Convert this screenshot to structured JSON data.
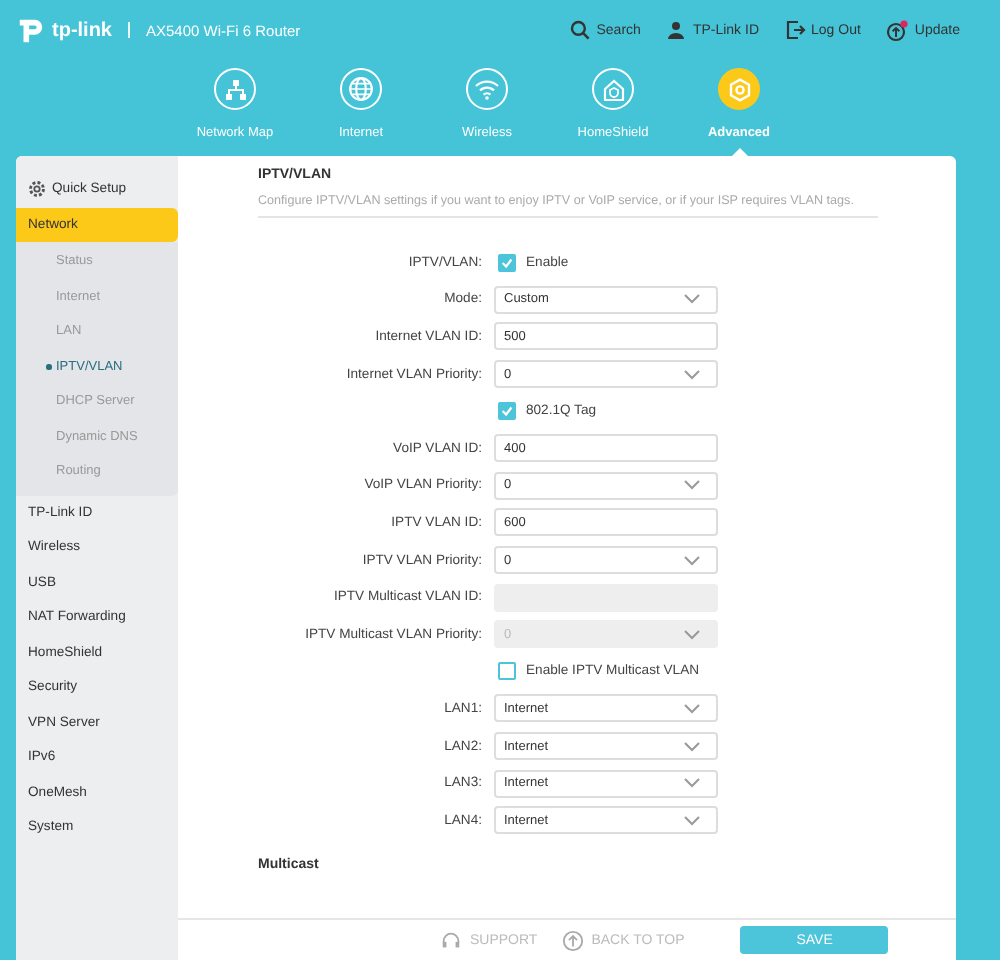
{
  "header": {
    "logo": "tp-link",
    "model": "AX5400 Wi-Fi 6 Router",
    "links": [
      {
        "label": "Search",
        "kind": "search"
      },
      {
        "label": "TP-Link ID",
        "kind": "user"
      },
      {
        "label": "Log Out",
        "kind": "logout"
      },
      {
        "label": "Update",
        "kind": "update"
      }
    ]
  },
  "nav": [
    {
      "label": "Network Map",
      "kind": "map",
      "selected": false
    },
    {
      "label": "Internet",
      "kind": "globe",
      "selected": false
    },
    {
      "label": "Wireless",
      "kind": "wifi",
      "selected": false
    },
    {
      "label": "HomeShield",
      "kind": "home",
      "selected": false
    },
    {
      "label": "Advanced",
      "kind": "gear",
      "selected": true
    }
  ],
  "sidebar": {
    "items": [
      {
        "label": "Quick Setup",
        "kind": "setup",
        "selected": false
      },
      {
        "label": "Network",
        "kind": "link",
        "selected": true,
        "children": [
          {
            "label": "Status",
            "selected": false
          },
          {
            "label": "Internet",
            "selected": false
          },
          {
            "label": "LAN",
            "selected": false
          },
          {
            "label": "IPTV/VLAN",
            "selected": true
          },
          {
            "label": "DHCP Server",
            "selected": false
          },
          {
            "label": "Dynamic DNS",
            "selected": false
          },
          {
            "label": "Routing",
            "selected": false
          }
        ]
      },
      {
        "label": "TP-Link ID",
        "kind": "link",
        "selected": false
      },
      {
        "label": "Wireless",
        "kind": "link",
        "selected": false
      },
      {
        "label": "USB",
        "kind": "link",
        "selected": false
      },
      {
        "label": "NAT Forwarding",
        "kind": "link",
        "selected": false
      },
      {
        "label": "HomeShield",
        "kind": "link",
        "selected": false
      },
      {
        "label": "Security",
        "kind": "link",
        "selected": false
      },
      {
        "label": "VPN Server",
        "kind": "link",
        "selected": false
      },
      {
        "label": "IPv6",
        "kind": "link",
        "selected": false
      },
      {
        "label": "OneMesh",
        "kind": "link",
        "selected": false
      },
      {
        "label": "System",
        "kind": "link",
        "selected": false
      }
    ]
  },
  "section": {
    "title": "IPTV/VLAN",
    "description": "Configure IPTV/VLAN settings if you want to enjoy IPTV or VoIP service, or if your ISP requires VLAN tags.",
    "fields": [
      {
        "kind": "checkbox",
        "label": "IPTV/VLAN:",
        "text": "Enable",
        "checked": true
      },
      {
        "kind": "select",
        "label": "Mode:",
        "value": "Custom",
        "disabled": false
      },
      {
        "kind": "text",
        "label": "Internet VLAN ID:",
        "value": "500",
        "disabled": false
      },
      {
        "kind": "select",
        "label": "Internet VLAN Priority:",
        "value": "0",
        "disabled": false
      },
      {
        "kind": "checkbox",
        "text": "802.1Q Tag",
        "checked": true
      },
      {
        "kind": "text",
        "label": "VoIP VLAN ID:",
        "value": "400",
        "disabled": false
      },
      {
        "kind": "select",
        "label": "VoIP VLAN Priority:",
        "value": "0",
        "disabled": false
      },
      {
        "kind": "text",
        "label": "IPTV VLAN ID:",
        "value": "600",
        "disabled": false
      },
      {
        "kind": "select",
        "label": "IPTV VLAN Priority:",
        "value": "0",
        "disabled": false
      },
      {
        "kind": "text",
        "label": "IPTV Multicast VLAN ID:",
        "disabled": true
      },
      {
        "kind": "select",
        "label": "IPTV Multicast VLAN Priority:",
        "value": "0",
        "disabled": true
      },
      {
        "kind": "checkbox",
        "text": "Enable IPTV Multicast VLAN",
        "checked": false
      },
      {
        "kind": "select",
        "label": "LAN1:",
        "value": "Internet",
        "disabled": false
      },
      {
        "kind": "select",
        "label": "LAN2:",
        "value": "Internet",
        "disabled": false
      },
      {
        "kind": "select",
        "label": "LAN3:",
        "value": "Internet",
        "disabled": false
      },
      {
        "kind": "select",
        "label": "LAN4:",
        "value": "Internet",
        "disabled": false
      }
    ]
  },
  "next_section": {
    "title": "Multicast"
  },
  "footer": {
    "support": "SUPPORT",
    "back_to_top": "BACK TO TOP",
    "save": "SAVE"
  }
}
